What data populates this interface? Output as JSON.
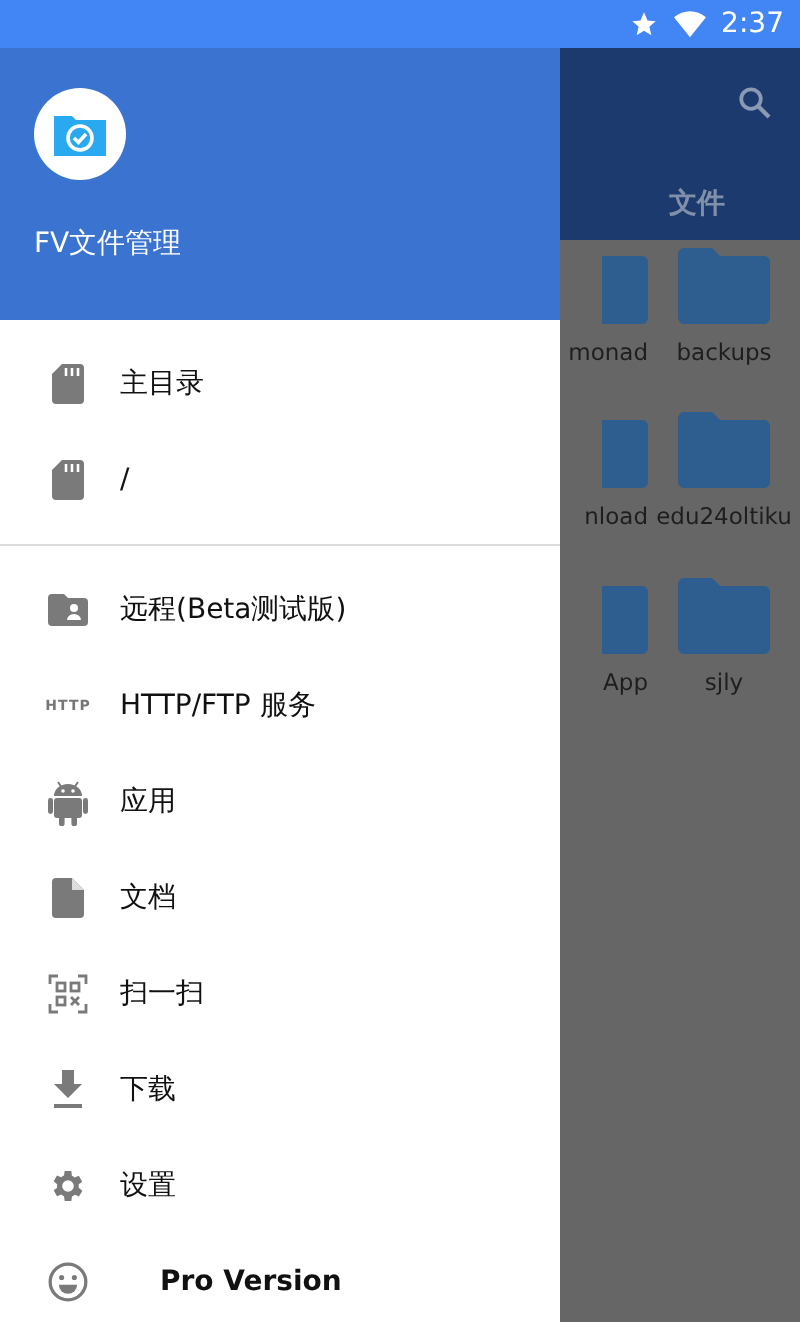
{
  "status_bar": {
    "time": "2:37"
  },
  "background_app": {
    "tab_label": "文件",
    "folders": [
      {
        "name": "monad"
      },
      {
        "name": "backups"
      },
      {
        "name": "nload"
      },
      {
        "name": "edu24oltiku"
      },
      {
        "name": "App"
      },
      {
        "name": "sjly"
      }
    ]
  },
  "drawer": {
    "title": "FV文件管理",
    "sections": [
      {
        "items": [
          {
            "kind": "storage",
            "label": "主目录"
          },
          {
            "kind": "storage",
            "label": "/"
          }
        ]
      },
      {
        "items": [
          {
            "kind": "remote",
            "label": "远程(Beta测试版)"
          },
          {
            "kind": "http",
            "icon_text": "HTTP",
            "label": "HTTP/FTP 服务"
          },
          {
            "kind": "android",
            "label": "应用"
          },
          {
            "kind": "document",
            "label": "文档"
          },
          {
            "kind": "scan",
            "label": "扫一扫"
          },
          {
            "kind": "download",
            "label": "下载"
          },
          {
            "kind": "settings",
            "label": "设置"
          },
          {
            "kind": "promo",
            "label": "Pro Version"
          }
        ]
      }
    ]
  }
}
